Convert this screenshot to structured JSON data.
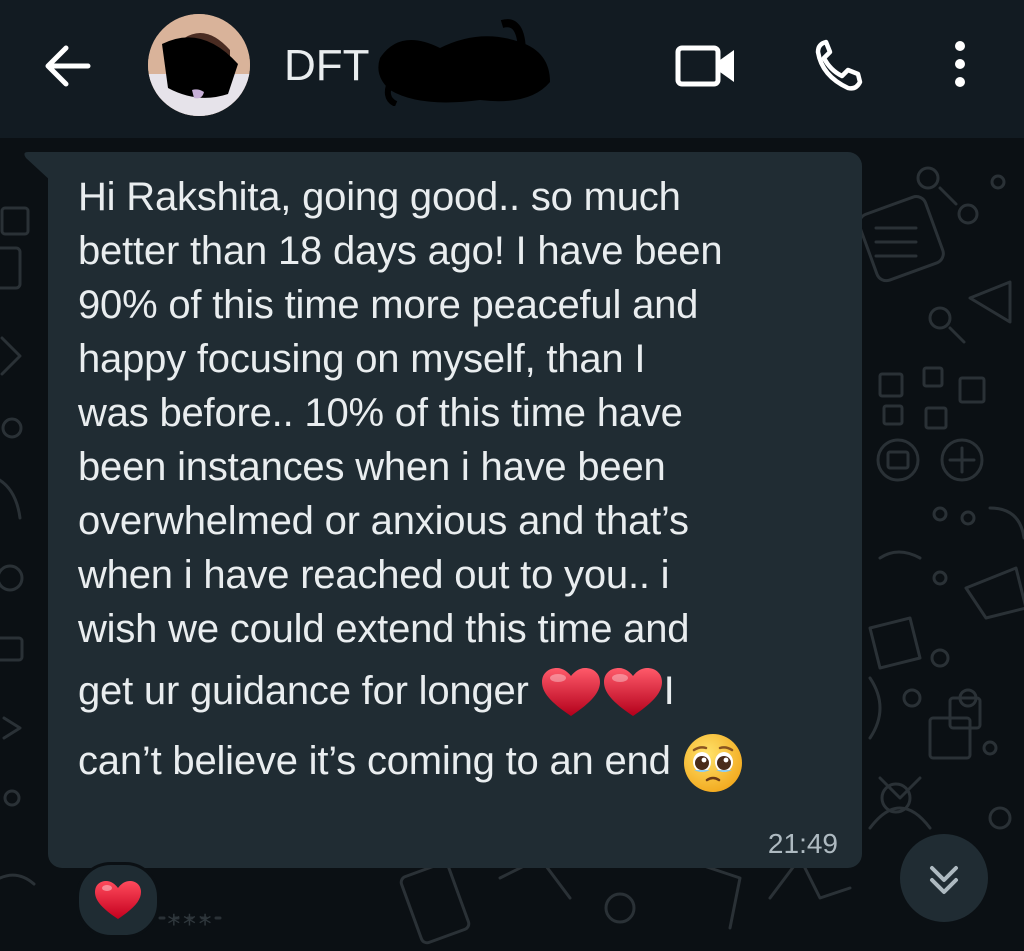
{
  "header": {
    "back_icon": "arrow-back-icon",
    "contact_name": "DFT C...",
    "video_icon": "video-call-icon",
    "call_icon": "phone-icon",
    "menu_icon": "more-vert-icon"
  },
  "message": {
    "lines": [
      "Hi Rakshita, going good.. so much",
      "better than 18 days ago! I have been",
      "90% of this time more peaceful and",
      "happy focusing on myself, than I",
      "was before.. 10% of this time have",
      "been instances when i have been",
      "overwhelmed or anxious and that’s",
      "when i have reached out to you.. i",
      "wish we could extend this time and",
      "get ur guidance for longer",
      "I",
      "can’t believe it’s coming to an end"
    ],
    "emoji_hearts": "red-heart-emoji",
    "emoji_end": "pleading-face-emoji",
    "time": "21:49"
  },
  "reaction": {
    "emoji": "red-heart-emoji"
  },
  "scroll": {
    "icon": "double-chevron-down-icon"
  },
  "colors": {
    "header_bg": "#121b22",
    "chat_bg": "#0b1014",
    "bubble_bg": "#202c33",
    "text": "#e9edef",
    "meta_text": "#aebac1"
  }
}
